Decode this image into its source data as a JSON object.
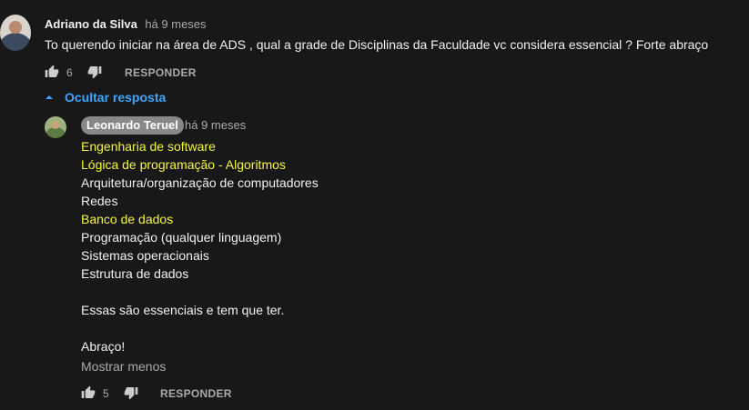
{
  "comment": {
    "author": "Adriano da Silva",
    "time": "há 9 meses",
    "text": "To querendo iniciar na área de ADS , qual a grade de Disciplinas da Faculdade vc considera essencial ? Forte abraço",
    "likes": "6",
    "reply_label": "RESPONDER"
  },
  "replies_toggle": {
    "label": "Ocultar resposta",
    "icon": "caret-up-icon"
  },
  "reply": {
    "author": "Leonardo Teruel",
    "time": "há 9 meses",
    "lines": [
      {
        "text": "Engenharia de software",
        "highlight": true
      },
      {
        "text": "Lógica de programação - Algoritmos",
        "highlight": true
      },
      {
        "text": "Arquitetura/organização de computadores",
        "highlight": false
      },
      {
        "text": "Redes",
        "highlight": false
      },
      {
        "text": "Banco de dados",
        "highlight": true
      },
      {
        "text": "Programação (qualquer linguagem)",
        "highlight": false
      },
      {
        "text": "Sistemas operacionais",
        "highlight": false
      },
      {
        "text": "Estrutura de dados",
        "highlight": false
      },
      {
        "text": "",
        "highlight": false
      },
      {
        "text": "Essas são essenciais e tem que ter.",
        "highlight": false
      },
      {
        "text": "",
        "highlight": false
      },
      {
        "text": "Abraço!",
        "highlight": false
      }
    ],
    "show_less": "Mostrar menos",
    "likes": "5",
    "reply_label": "RESPONDER"
  },
  "colors": {
    "background": "#181818",
    "link_blue": "#3ea6ff",
    "highlight_yellow": "#f5f542",
    "muted": "#aaaaaa"
  }
}
